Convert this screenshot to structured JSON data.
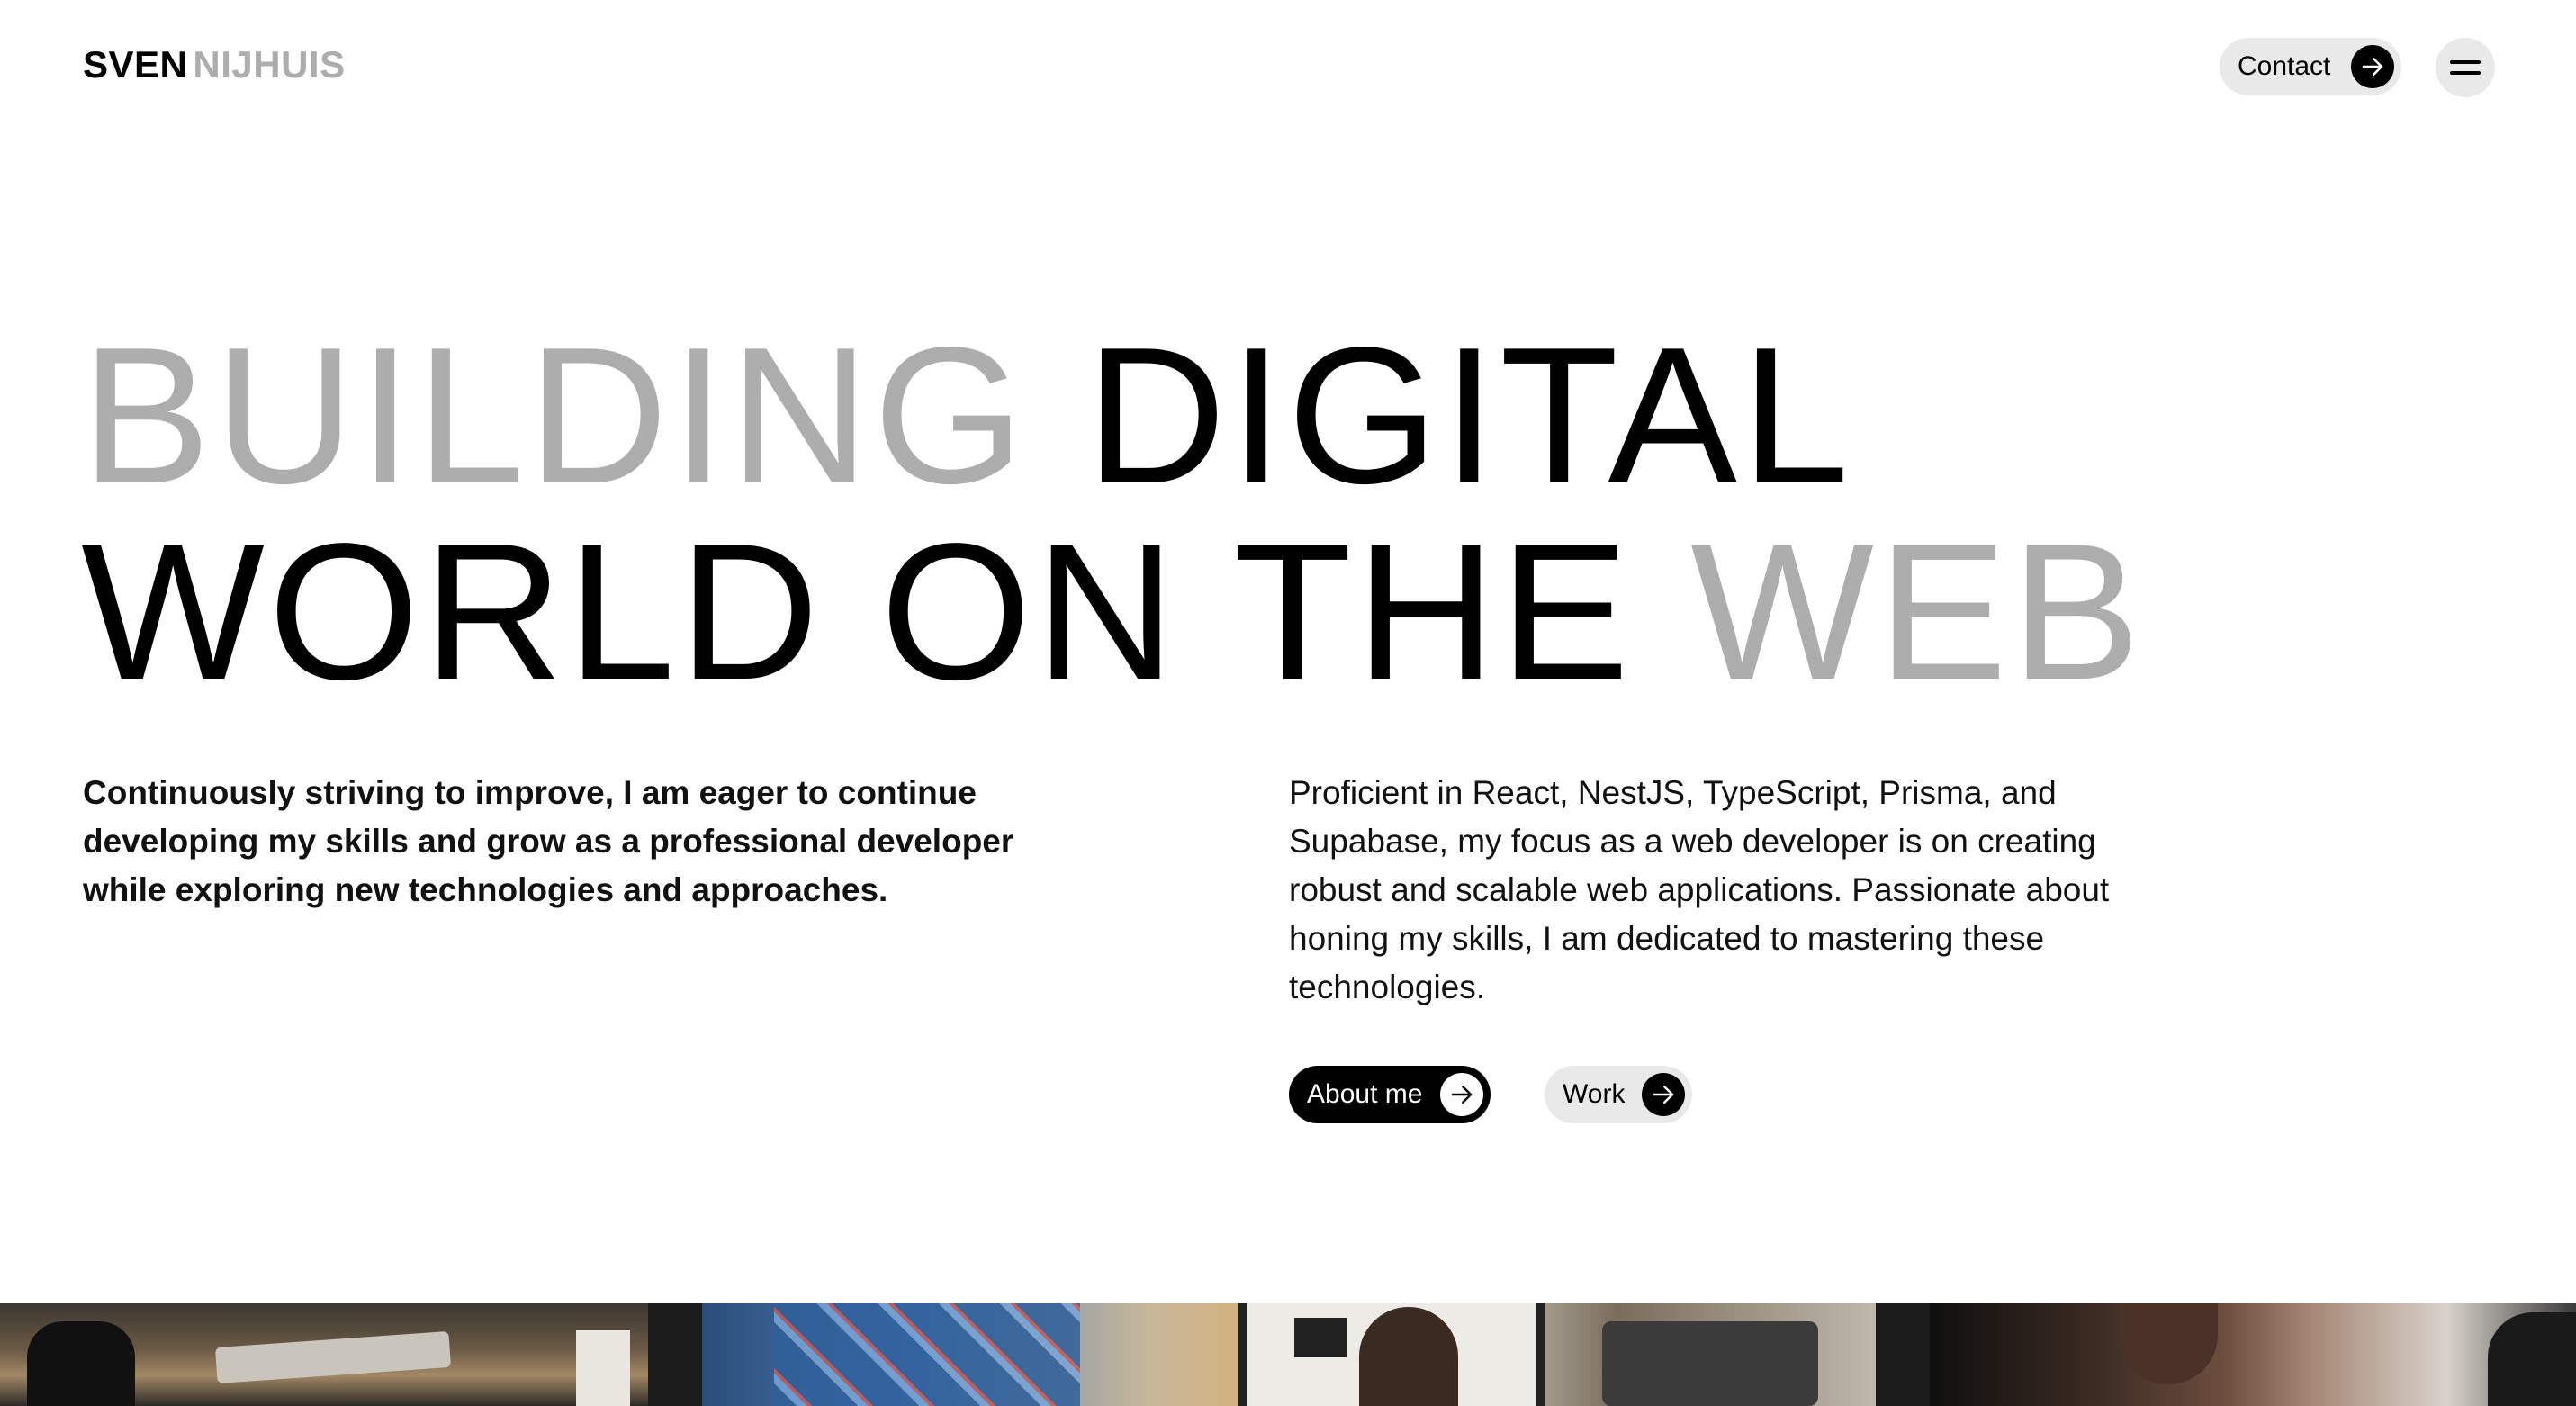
{
  "header": {
    "logo_first": "SVEN",
    "logo_last": "NIJHUIS",
    "contact_label": "Contact",
    "menu_icon": "hamburger-menu-icon"
  },
  "hero": {
    "headline_word1": "BUILDING",
    "headline_word2": "DIGITAL",
    "headline_word3": "WORLD ON THE",
    "headline_word4": "WEB",
    "intro_left": "Continuously striving to improve, I am eager to continue developing my skills and grow as a professional developer while exploring new technologies and approaches.",
    "intro_right": "Proficient in React, NestJS, TypeScript, Prisma, and Supabase, my focus as a web developer is on creating robust and scalable web applications. Passionate about honing my skills, I am dedicated to mastering these technologies."
  },
  "actions": {
    "about_label": "About me",
    "work_label": "Work",
    "arrow_icon": "arrow-right-icon"
  },
  "colors": {
    "accent": "#000000",
    "muted_text": "#adadad",
    "pill_background": "#e9e9e9",
    "background": "#ffffff"
  }
}
